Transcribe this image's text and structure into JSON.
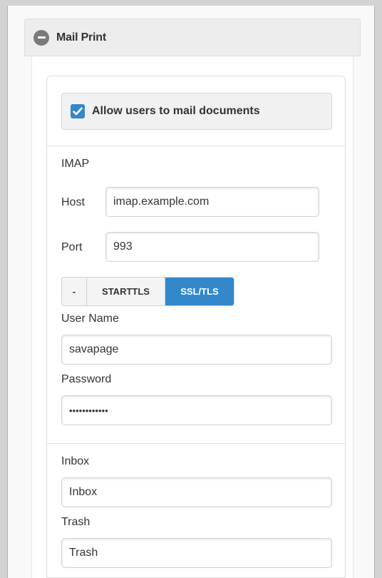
{
  "section": {
    "title": "Mail Print",
    "allow_label": "Allow users to mail documents",
    "allow_checked": true
  },
  "imap": {
    "heading": "IMAP",
    "host_label": "Host",
    "host_value": "imap.example.com",
    "port_label": "Port",
    "port_value": "993",
    "security_options": [
      "-",
      "STARTTLS",
      "SSL/TLS"
    ],
    "security_selected": "SSL/TLS",
    "user_label": "User Name",
    "user_value": "savapage",
    "password_label": "Password",
    "password_value": "••••••••••••"
  },
  "folders": {
    "inbox_label": "Inbox",
    "inbox_value": "Inbox",
    "trash_label": "Trash",
    "trash_value": "Trash"
  },
  "colors": {
    "accent": "#3388cc"
  }
}
